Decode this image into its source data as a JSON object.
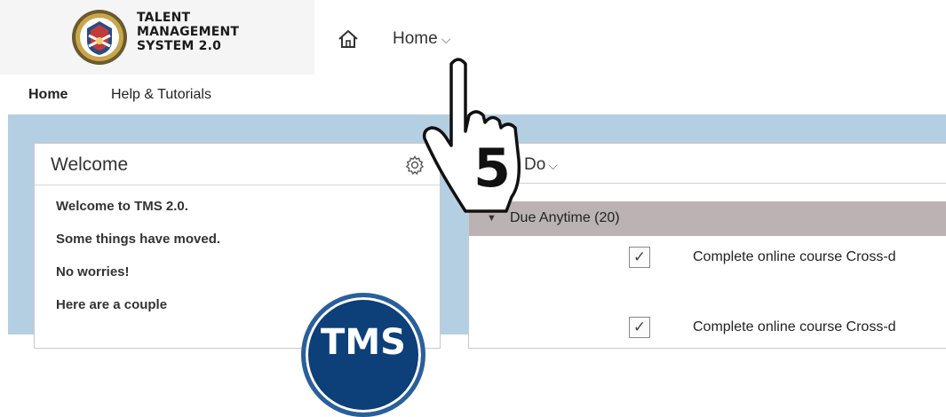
{
  "logo": {
    "line1": "TALENT",
    "line2": "MANAGEMENT",
    "line3": "SYSTEM 2.0"
  },
  "header": {
    "home_menu_label": "Home",
    "home_menu_chevron": "⌵",
    "home_icon": "house-icon"
  },
  "subnav": {
    "home_label": "Home",
    "help_label": "Help & Tutorials"
  },
  "welcome": {
    "title": "Welcome",
    "settings_icon": "gear-icon",
    "lines": [
      "Welcome to TMS 2.0.",
      "Some things have moved.",
      "No worries!",
      "Here are a couple"
    ],
    "badge_text": "TMS"
  },
  "todo": {
    "title_fragment": "Do",
    "group_label": "Due Anytime (20)",
    "tasks": [
      {
        "text": "Complete online course Cross-d",
        "checkbox_glyph": "✓"
      },
      {
        "text": "Complete online course Cross-d",
        "checkbox_glyph": "✓"
      }
    ]
  },
  "overlay": {
    "step_number": "5",
    "icon": "pointing-hand-icon"
  },
  "colors": {
    "main_background": "#b5cfe2",
    "group_bar": "#bbb3b3",
    "badge_blue": "#0d3f79"
  }
}
